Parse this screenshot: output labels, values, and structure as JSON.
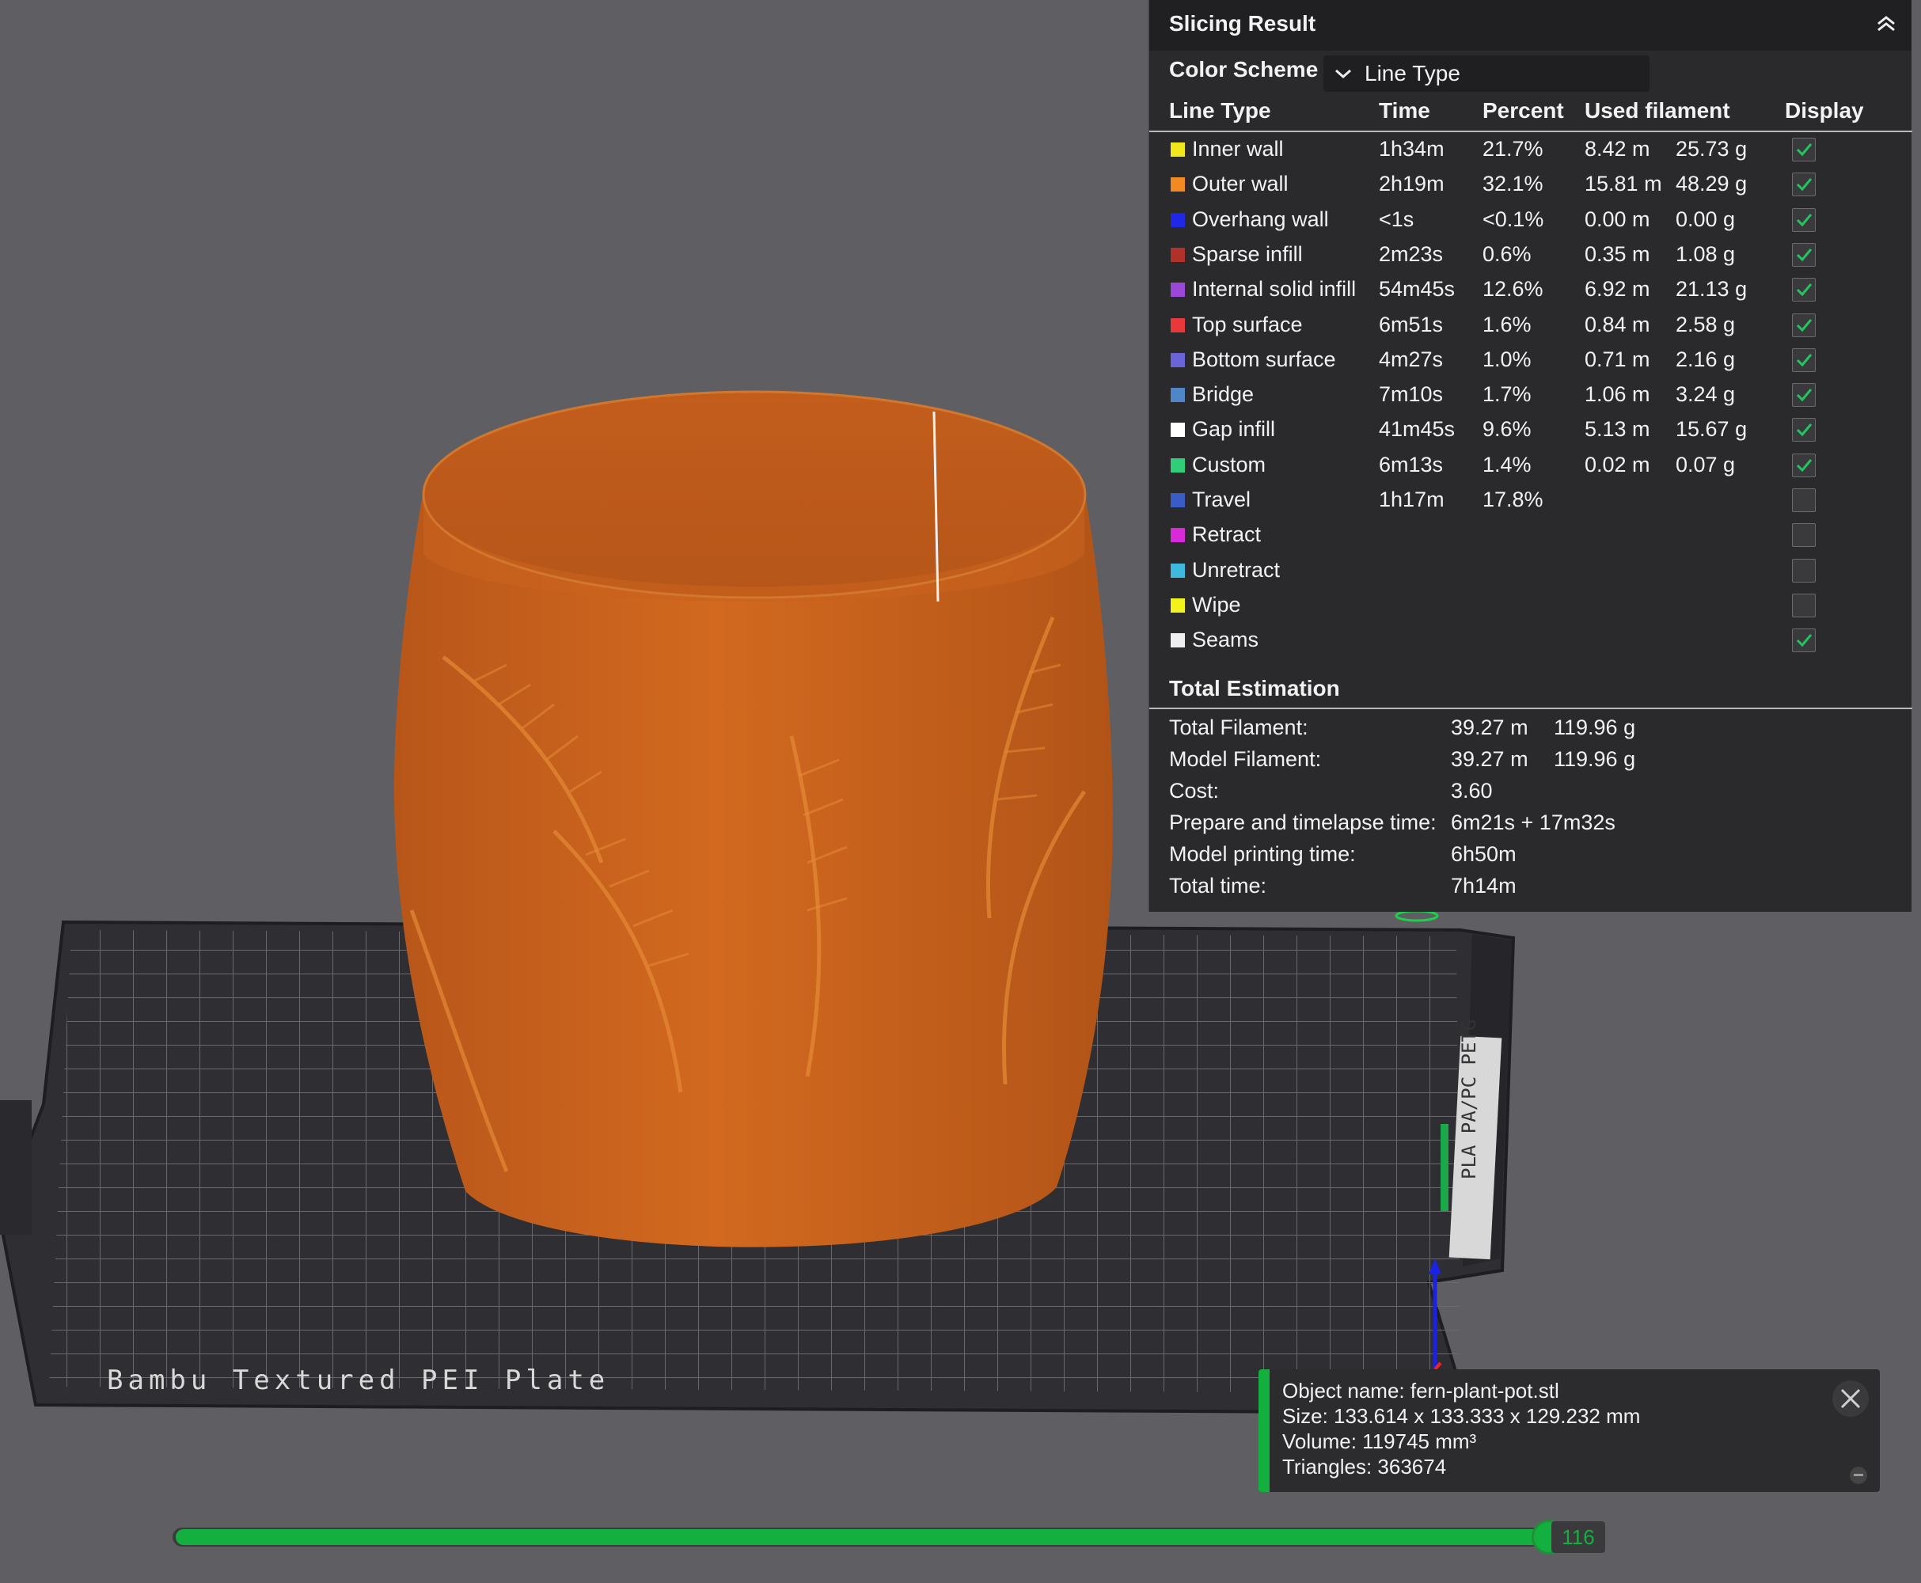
{
  "panel": {
    "title": "Slicing Result",
    "color_scheme_label": "Color Scheme",
    "color_scheme_value": "Line Type",
    "columns": [
      "Line Type",
      "Time",
      "Percent",
      "Used filament",
      "Display"
    ],
    "rows": [
      {
        "name": "Inner wall",
        "color": "#f2e61c",
        "time": "1h34m",
        "percent": "21.7%",
        "length": "8.42 m",
        "weight": "25.73 g",
        "display": true,
        "has_checkbox": true
      },
      {
        "name": "Outer wall",
        "color": "#f28a22",
        "time": "2h19m",
        "percent": "32.1%",
        "length": "15.81 m",
        "weight": "48.29 g",
        "display": true,
        "has_checkbox": true
      },
      {
        "name": "Overhang wall",
        "color": "#1f28e6",
        "time": "<1s",
        "percent": "<0.1%",
        "length": "0.00 m",
        "weight": "0.00 g",
        "display": true,
        "has_checkbox": true
      },
      {
        "name": "Sparse infill",
        "color": "#b0302a",
        "time": "2m23s",
        "percent": "0.6%",
        "length": "0.35 m",
        "weight": "1.08 g",
        "display": true,
        "has_checkbox": true
      },
      {
        "name": "Internal solid infill",
        "color": "#9b48d6",
        "time": "54m45s",
        "percent": "12.6%",
        "length": "6.92 m",
        "weight": "21.13 g",
        "display": true,
        "has_checkbox": true
      },
      {
        "name": "Top surface",
        "color": "#e8383a",
        "time": "6m51s",
        "percent": "1.6%",
        "length": "0.84 m",
        "weight": "2.58 g",
        "display": true,
        "has_checkbox": true
      },
      {
        "name": "Bottom surface",
        "color": "#6a64d8",
        "time": "4m27s",
        "percent": "1.0%",
        "length": "0.71 m",
        "weight": "2.16 g",
        "display": true,
        "has_checkbox": true
      },
      {
        "name": "Bridge",
        "color": "#4f86c8",
        "time": "7m10s",
        "percent": "1.7%",
        "length": "1.06 m",
        "weight": "3.24 g",
        "display": true,
        "has_checkbox": true
      },
      {
        "name": "Gap infill",
        "color": "#ffffff",
        "time": "41m45s",
        "percent": "9.6%",
        "length": "5.13 m",
        "weight": "15.67 g",
        "display": true,
        "has_checkbox": true
      },
      {
        "name": "Custom",
        "color": "#2ecf78",
        "time": "6m13s",
        "percent": "1.4%",
        "length": "0.02 m",
        "weight": "0.07 g",
        "display": true,
        "has_checkbox": true
      },
      {
        "name": "Travel",
        "color": "#3a5cc6",
        "time": "1h17m",
        "percent": "17.8%",
        "length": "",
        "weight": "",
        "display": false,
        "has_checkbox": true
      },
      {
        "name": "Retract",
        "color": "#d82ad8",
        "time": "",
        "percent": "",
        "length": "",
        "weight": "",
        "display": false,
        "has_checkbox": true
      },
      {
        "name": "Unretract",
        "color": "#3fb8e0",
        "time": "",
        "percent": "",
        "length": "",
        "weight": "",
        "display": false,
        "has_checkbox": true
      },
      {
        "name": "Wipe",
        "color": "#f2f21c",
        "time": "",
        "percent": "",
        "length": "",
        "weight": "",
        "display": false,
        "has_checkbox": true
      },
      {
        "name": "Seams",
        "color": "#eeeeee",
        "time": "",
        "percent": "",
        "length": "",
        "weight": "",
        "display": true,
        "has_checkbox": true
      }
    ],
    "total_title": "Total Estimation",
    "totals": [
      {
        "label": "Total Filament:",
        "value1": "39.27 m",
        "value2": "119.96 g"
      },
      {
        "label": "Model Filament:",
        "value1": "39.27 m",
        "value2": "119.96 g"
      },
      {
        "label": "Cost:",
        "value1": "3.60",
        "value2": ""
      },
      {
        "label": "Prepare and timelapse time:",
        "value1": "6m21s + 17m32s",
        "value2": ""
      },
      {
        "label": "Model printing time:",
        "value1": "6h50m",
        "value2": ""
      },
      {
        "label": "Total time:",
        "value1": "7h14m",
        "value2": ""
      }
    ]
  },
  "object_info": {
    "name_line": "Object name: fern-plant-pot.stl",
    "size_line": "Size: 133.614 x 133.333 x 129.232 mm",
    "volume_line": "Volume: 119745 mm³",
    "triangles_line": "Triangles: 363674"
  },
  "plate": {
    "label": "Bambu Textured PEI Plate",
    "side_label": "PLA PA/PC PETG"
  },
  "slider": {
    "layer": "116",
    "progress": 0.987
  },
  "colors": {
    "accent": "#13b040",
    "model": "#c8611f",
    "panel_bg": "#2a2a2d",
    "viewport_bg": "#5f5f63"
  }
}
